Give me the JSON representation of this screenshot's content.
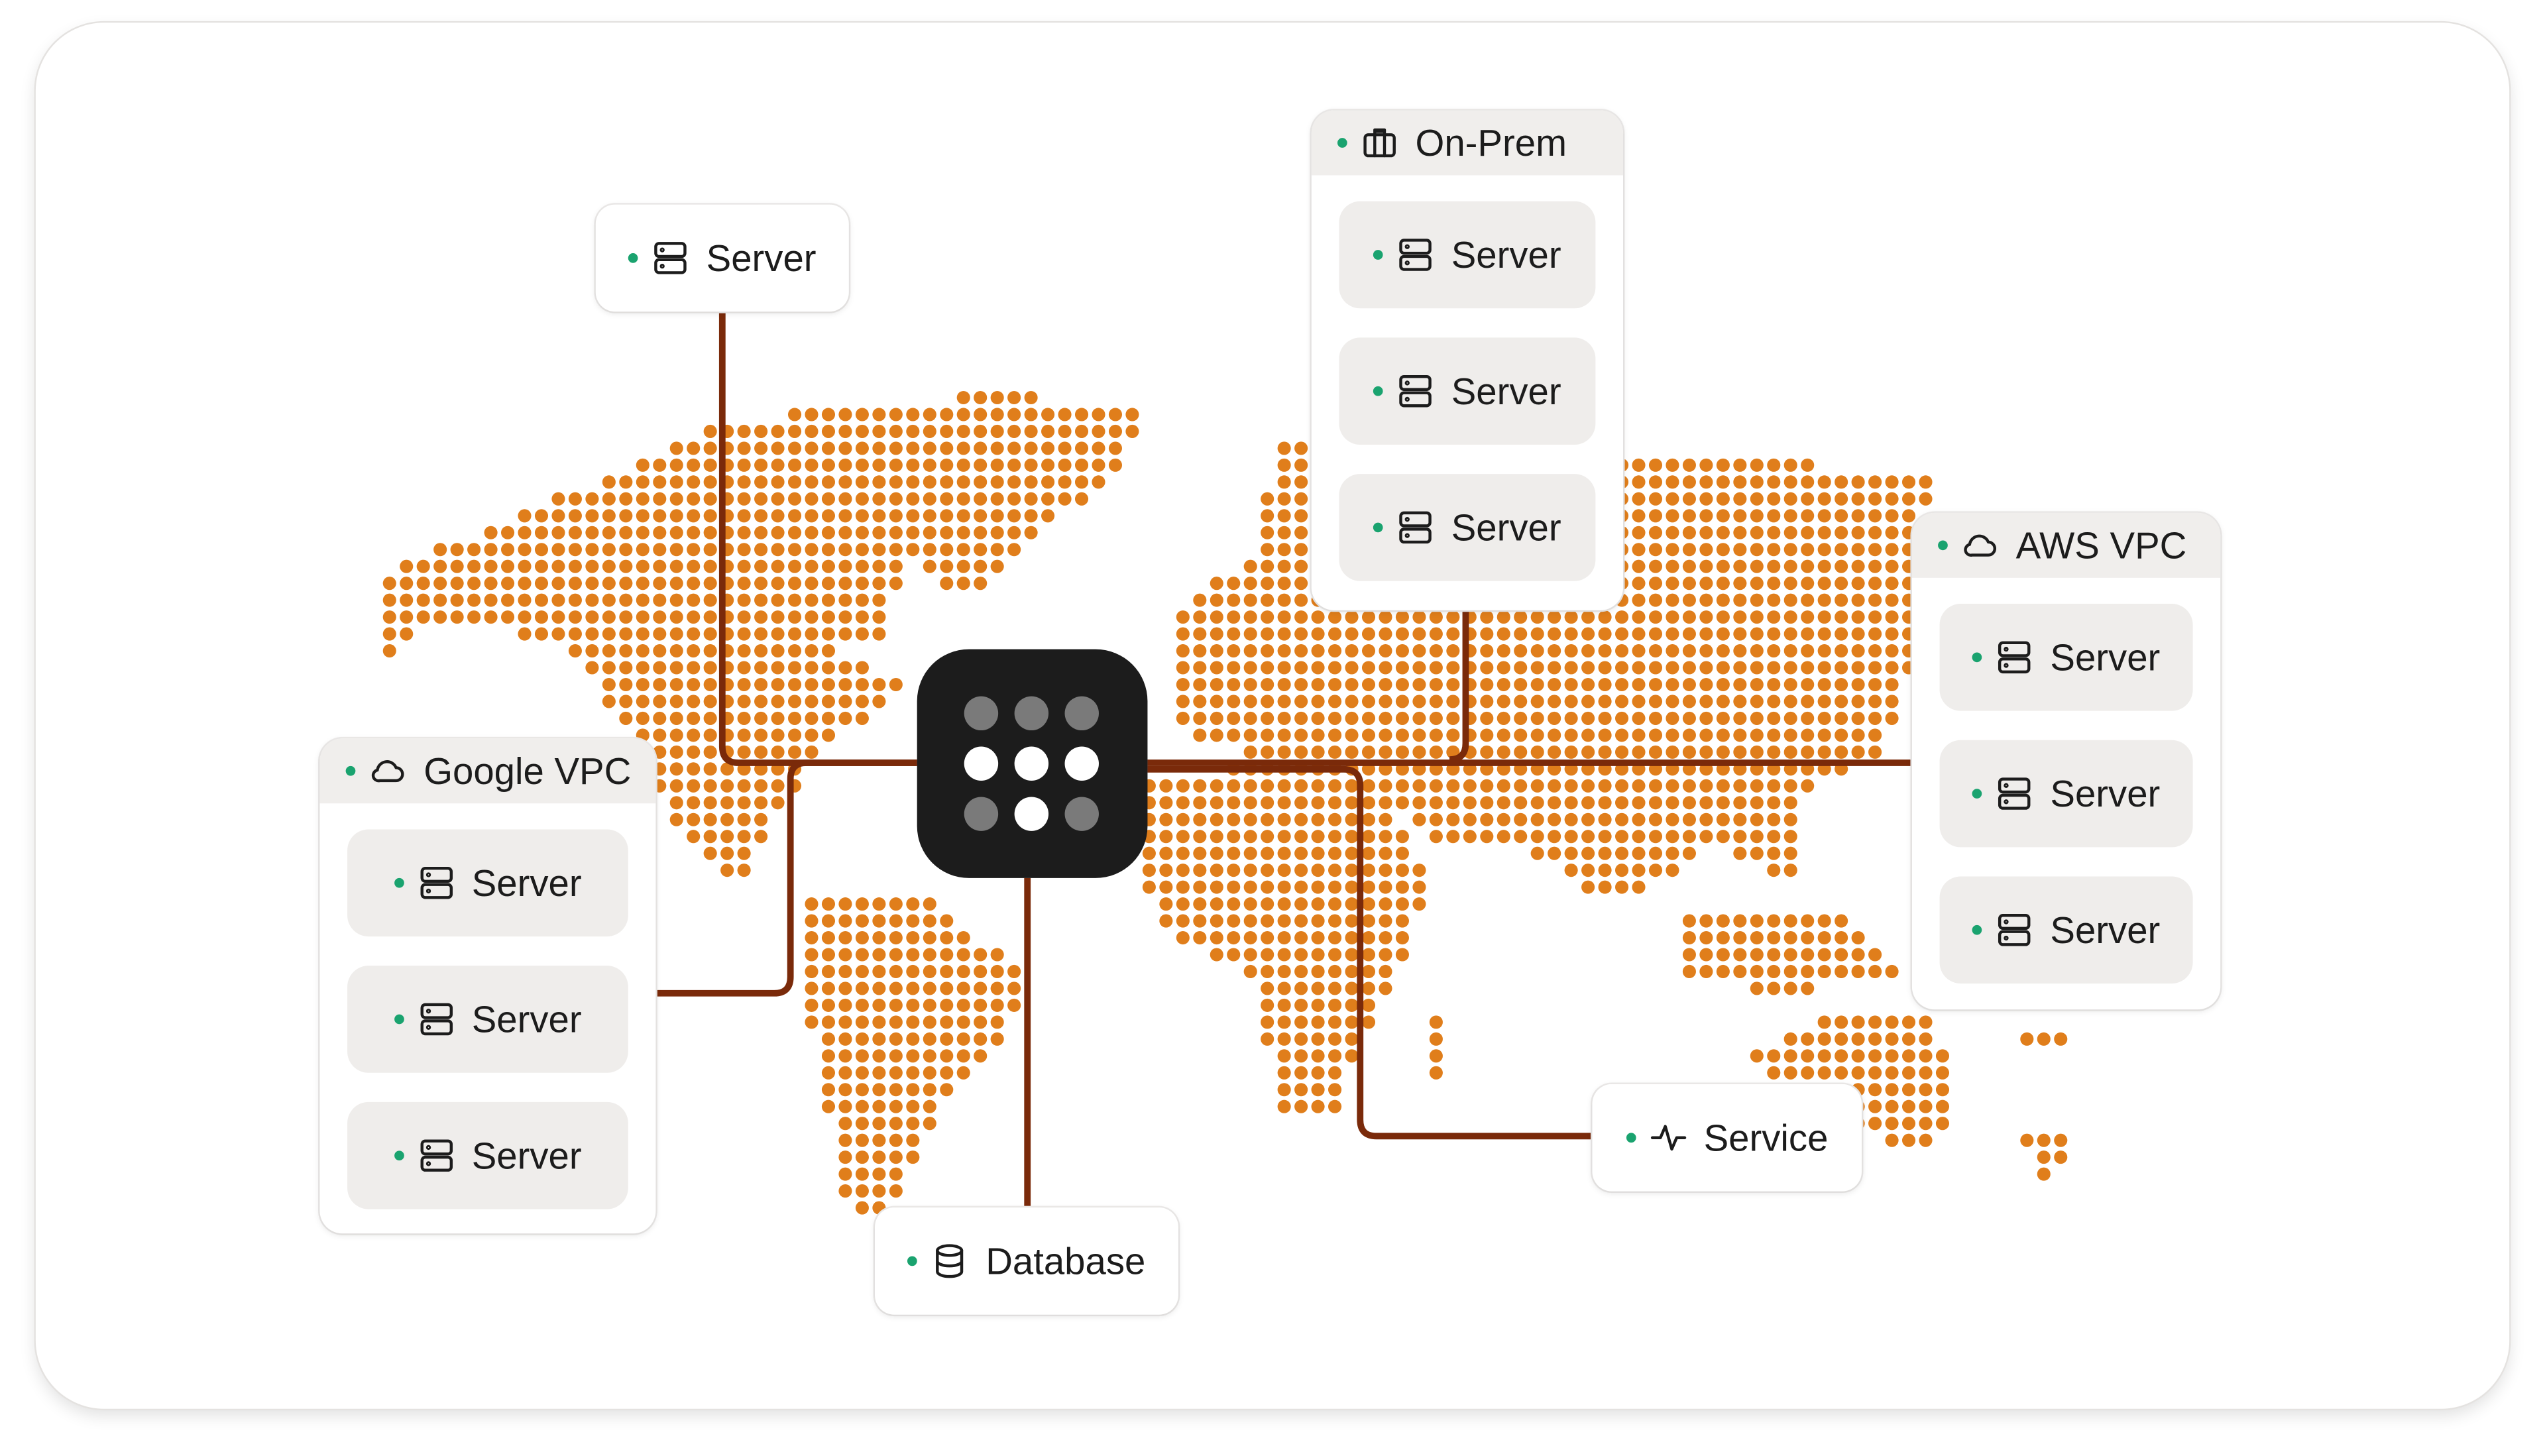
{
  "colors": {
    "map_dot": "#E07E1B",
    "connector": "#7A2A0A",
    "status": "#1AA36F",
    "hub": "#1C1C1C",
    "hub_dot_on": "#FFFFFF",
    "hub_dot_off": "#7A7A7A"
  },
  "hub": {
    "icon": "grid-dots-logo",
    "pattern": [
      0,
      0,
      0,
      1,
      1,
      1,
      0,
      1,
      0
    ]
  },
  "nodes": [
    {
      "id": "server-top",
      "label": "Server",
      "icon": "server-icon",
      "status": "online"
    },
    {
      "id": "database",
      "label": "Database",
      "icon": "database-icon",
      "status": "online"
    },
    {
      "id": "service",
      "label": "Service",
      "icon": "activity-icon",
      "status": "online"
    }
  ],
  "groups": [
    {
      "id": "on-prem",
      "label": "On-Prem",
      "icon": "building-icon",
      "status": "online",
      "items": [
        "Server",
        "Server",
        "Server"
      ]
    },
    {
      "id": "aws-vpc",
      "label": "AWS VPC",
      "icon": "cloud-icon",
      "status": "online",
      "items": [
        "Server",
        "Server",
        "Server"
      ]
    },
    {
      "id": "google-vpc",
      "label": "Google VPC",
      "icon": "cloud-icon",
      "status": "online",
      "items": [
        "Server",
        "Server",
        "Server"
      ]
    }
  ]
}
